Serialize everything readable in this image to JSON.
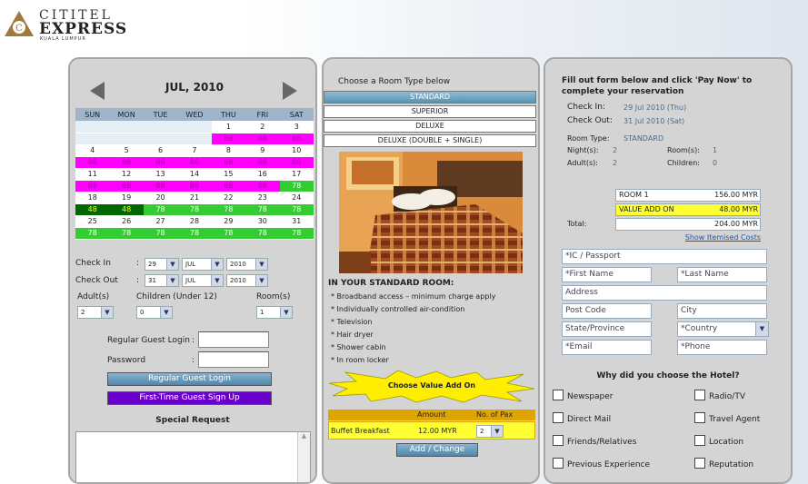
{
  "logo": {
    "name": "CITITEL",
    "express": "EXPRESS",
    "city": "KUALA LUMPUR"
  },
  "calendar": {
    "month": "JUL, 2010",
    "days": [
      "SUN",
      "MON",
      "TUE",
      "WED",
      "THU",
      "FRI",
      "SAT"
    ],
    "rows": [
      [
        [
          "",
          "e"
        ],
        [
          "",
          "e"
        ],
        [
          "",
          "e"
        ],
        [
          "",
          "e"
        ],
        [
          "1",
          "w"
        ],
        [
          "2",
          "w"
        ],
        [
          "3",
          "w"
        ]
      ],
      [
        [
          "",
          "e"
        ],
        [
          "",
          "e"
        ],
        [
          "",
          "e"
        ],
        [
          "",
          "e"
        ],
        [
          "88",
          "m"
        ],
        [
          "88",
          "m"
        ],
        [
          "88",
          "m"
        ]
      ],
      [
        [
          "4",
          "w"
        ],
        [
          "5",
          "w"
        ],
        [
          "6",
          "w"
        ],
        [
          "7",
          "w"
        ],
        [
          "8",
          "w"
        ],
        [
          "9",
          "w"
        ],
        [
          "10",
          "w"
        ]
      ],
      [
        [
          "88",
          "m"
        ],
        [
          "88",
          "m"
        ],
        [
          "88",
          "m"
        ],
        [
          "88",
          "m"
        ],
        [
          "88",
          "m"
        ],
        [
          "88",
          "m"
        ],
        [
          "88",
          "m"
        ]
      ],
      [
        [
          "11",
          "w"
        ],
        [
          "12",
          "w"
        ],
        [
          "13",
          "w"
        ],
        [
          "14",
          "w"
        ],
        [
          "15",
          "w"
        ],
        [
          "16",
          "w"
        ],
        [
          "17",
          "w"
        ]
      ],
      [
        [
          "88",
          "m"
        ],
        [
          "88",
          "m"
        ],
        [
          "88",
          "m"
        ],
        [
          "88",
          "m"
        ],
        [
          "88",
          "m"
        ],
        [
          "88",
          "m"
        ],
        [
          "78",
          "g"
        ]
      ],
      [
        [
          "18",
          "w"
        ],
        [
          "19",
          "w"
        ],
        [
          "20",
          "w"
        ],
        [
          "21",
          "w"
        ],
        [
          "22",
          "w"
        ],
        [
          "23",
          "w"
        ],
        [
          "24",
          "w"
        ]
      ],
      [
        [
          "48",
          "dg"
        ],
        [
          "48",
          "dg"
        ],
        [
          "78",
          "g"
        ],
        [
          "78",
          "g"
        ],
        [
          "78",
          "g"
        ],
        [
          "78",
          "g"
        ],
        [
          "78",
          "g"
        ]
      ],
      [
        [
          "25",
          "w"
        ],
        [
          "26",
          "w"
        ],
        [
          "27",
          "w"
        ],
        [
          "28",
          "w"
        ],
        [
          "29",
          "w"
        ],
        [
          "30",
          "w"
        ],
        [
          "31",
          "w"
        ]
      ],
      [
        [
          "78",
          "g"
        ],
        [
          "78",
          "g"
        ],
        [
          "78",
          "g"
        ],
        [
          "78",
          "g"
        ],
        [
          "78",
          "g"
        ],
        [
          "78",
          "g"
        ],
        [
          "78",
          "g"
        ]
      ]
    ]
  },
  "booking": {
    "checkin_label": "Check In",
    "checkout_label": "Check Out",
    "colon": ":",
    "ci_day": "29",
    "ci_month": "JUL",
    "ci_year": "2010",
    "co_day": "31",
    "co_month": "JUL",
    "co_year": "2010",
    "adults_label": "Adult(s)",
    "children_label": "Children (Under 12)",
    "rooms_label": "Room(s)",
    "adults": "2",
    "children": "0",
    "rooms": "1"
  },
  "login": {
    "login_label": "Regular Guest Login",
    "login_colon": ":",
    "password_label": "Password",
    "password_colon": ":",
    "login_button": "Regular Guest Login",
    "signup_button": "First-Time Guest Sign Up",
    "special_request": "Special Request"
  },
  "rooms": {
    "heading": "Choose a Room Type below",
    "types": [
      "STANDARD",
      "SUPERIOR",
      "DELUXE",
      "DELUXE (DOUBLE + SINGLE)"
    ],
    "amenities_title": "IN YOUR STANDARD ROOM:",
    "amenities": [
      "* Broadband access – minimum charge apply",
      "* Individually controlled air-condition",
      "* Television",
      "* Hair dryer",
      "* Shower cabin",
      "* In room locker"
    ],
    "addon_burst": "Choose Value Add On",
    "addon_col_amount": "Amount",
    "addon_col_pax": "No. of Pax",
    "addon_name": "Buffet Breakfast",
    "addon_amount": "12.00 MYR",
    "addon_pax": "2",
    "add_change": "Add / Change"
  },
  "summary": {
    "title": "Fill out form below and click 'Pay Now' to complete your reservation",
    "checkin_label": "Check In:",
    "checkin": "29 Jul 2010 (Thu)",
    "checkout_label": "Check Out:",
    "checkout": "31 Jul 2010 (Sat)",
    "roomtype_label": "Room Type:",
    "roomtype": "STANDARD",
    "nights_label": "Night(s):",
    "nights": "2",
    "rooms_label": "Room(s):",
    "rooms": "1",
    "adults_label": "Adult(s):",
    "adults": "2",
    "children_label": "Children:",
    "children": "0",
    "cost_room_label": "ROOM 1",
    "cost_room": "156.00 MYR",
    "cost_addon_label": "VALUE ADD ON",
    "cost_addon": "48.00 MYR",
    "total_label": "Total:",
    "total": "204.00 MYR",
    "itemised": "Show Itemised Costs"
  },
  "form": {
    "ic": "*IC / Passport",
    "first": "*First Name",
    "last": "*Last Name",
    "address": "Address",
    "postcode": "Post Code",
    "city": "City",
    "state": "State/Province",
    "country": "*Country",
    "email": "*Email",
    "phone": "*Phone"
  },
  "survey": {
    "question": "Why did you choose the Hotel?",
    "options": [
      "Newspaper",
      "Radio/TV",
      "Direct Mail",
      "Travel Agent",
      "Friends/Relatives",
      "Location",
      "Previous Experience",
      "Reputation"
    ]
  },
  "colors": {
    "panel": "#d4d4d4",
    "available": "#33cc33",
    "peak": "#ff00ff",
    "selected_button": "#5b8fb0",
    "signup": "#6600cc"
  }
}
